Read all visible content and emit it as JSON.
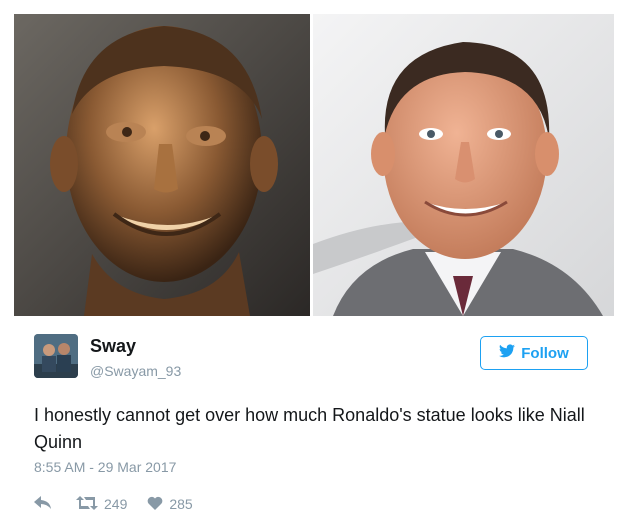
{
  "images": {
    "left_alt": "bronze-bust-photo",
    "right_alt": "smiling-man-photo"
  },
  "tweet": {
    "display_name": "Sway",
    "handle": "@Swayam_93",
    "follow_label": "Follow",
    "text": "I honestly cannot get over how much Ronaldo's statue looks like Niall Quinn",
    "timestamp": "8:55 AM - 29 Mar 2017",
    "retweets": "249",
    "likes": "285"
  },
  "colors": {
    "accent": "#1da1f2",
    "text": "#14171a",
    "muted": "#8899a6"
  },
  "icons": [
    "twitter-bird-icon",
    "reply-icon",
    "retweet-icon",
    "heart-icon"
  ]
}
